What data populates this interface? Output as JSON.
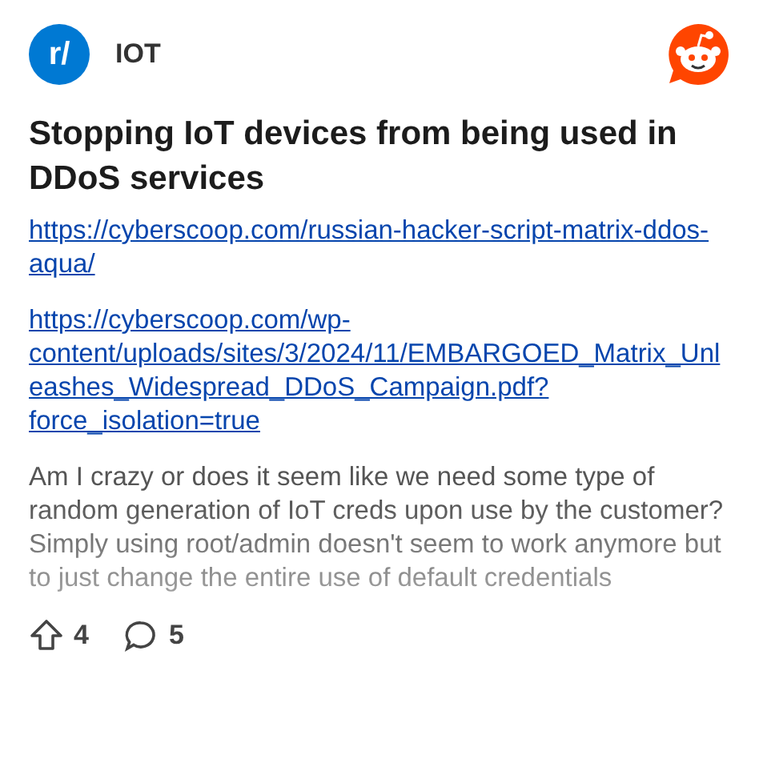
{
  "subreddit": {
    "avatar": "r/",
    "name": "IOT"
  },
  "post": {
    "title": "Stopping IoT devices from being used in DDoS services",
    "links": [
      "https://cyberscoop.com/russian-hacker-script-matrix-ddos-aqua/",
      "https://cyberscoop.com/wp-content/uploads/sites/3/2024/11/EMBARGOED_Matrix_Unleashes_Widespread_DDoS_Campaign.pdf?force_isolation=true"
    ],
    "body": "Am I crazy or does it seem like we need some type of random generation of IoT creds upon use by the customer? Simply using root/admin doesn't seem to work anymore but to just change the entire use of default credentials",
    "upvotes": "4",
    "comments": "5"
  }
}
